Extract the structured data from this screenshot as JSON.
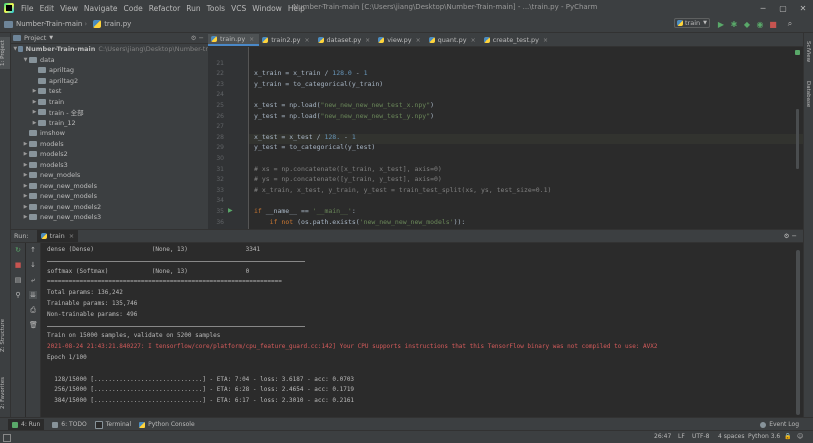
{
  "menu": [
    "File",
    "Edit",
    "View",
    "Navigate",
    "Code",
    "Refactor",
    "Run",
    "Tools",
    "VCS",
    "Window",
    "Help"
  ],
  "window_title": "Number-Train-main [C:\\Users\\jiang\\Desktop\\Number-Train-main] - ...\\train.py - PyCharm",
  "breadcrumb": {
    "project": "Number-Train-main",
    "file": "train.py"
  },
  "run_config": "train",
  "project": {
    "header": "Project",
    "root": "Number-Train-main",
    "root_path": "C:\\Users\\jiang\\Desktop\\Number-tr",
    "items": [
      {
        "label": "data",
        "indent": 1,
        "arrow": "▼"
      },
      {
        "label": "apriltag",
        "indent": 2,
        "arrow": ""
      },
      {
        "label": "apriltag2",
        "indent": 2,
        "arrow": ""
      },
      {
        "label": "test",
        "indent": 2,
        "arrow": "▶"
      },
      {
        "label": "train",
        "indent": 2,
        "arrow": "▶"
      },
      {
        "label": "train - 全部",
        "indent": 2,
        "arrow": "▶"
      },
      {
        "label": "train_12",
        "indent": 2,
        "arrow": "▶"
      },
      {
        "label": "imshow",
        "indent": 1,
        "arrow": ""
      },
      {
        "label": "models",
        "indent": 1,
        "arrow": "▶"
      },
      {
        "label": "models2",
        "indent": 1,
        "arrow": "▶"
      },
      {
        "label": "models3",
        "indent": 1,
        "arrow": "▶"
      },
      {
        "label": "new_models",
        "indent": 1,
        "arrow": "▶"
      },
      {
        "label": "new_new_models",
        "indent": 1,
        "arrow": "▶"
      },
      {
        "label": "new_new_models",
        "indent": 1,
        "arrow": "▶"
      },
      {
        "label": "new_new_models2",
        "indent": 1,
        "arrow": "▶"
      },
      {
        "label": "new_new_models3",
        "indent": 1,
        "arrow": "▶"
      }
    ]
  },
  "tabs": [
    {
      "label": "train.py",
      "active": true
    },
    {
      "label": "train2.py",
      "active": false
    },
    {
      "label": "dataset.py",
      "active": false
    },
    {
      "label": "view.py",
      "active": false
    },
    {
      "label": "quant.py",
      "active": false
    },
    {
      "label": "create_test.py",
      "active": false
    }
  ],
  "code_lines": [
    {
      "n": "",
      "text": ""
    },
    {
      "n": "21",
      "text": ""
    },
    {
      "n": "22",
      "text": "x_train = x_train / 128.0 - 1"
    },
    {
      "n": "23",
      "text": "y_train = to_categorical(y_train)"
    },
    {
      "n": "24",
      "text": ""
    },
    {
      "n": "25",
      "text": "x_test = np.load(\"new_new_new_new_test_x.npy\")"
    },
    {
      "n": "26",
      "text": "y_test = np.load(\"new_new_new_new_test_y.npy\")"
    },
    {
      "n": "27",
      "text": ""
    },
    {
      "n": "28",
      "text": "x_test = x_test / 128. - 1"
    },
    {
      "n": "29",
      "text": "y_test = to_categorical(y_test)"
    },
    {
      "n": "30",
      "text": ""
    },
    {
      "n": "31",
      "text": "# xs = np.concatenate([x_train, x_test], axis=0)"
    },
    {
      "n": "32",
      "text": "# ys = np.concatenate([y_train, y_test], axis=0)"
    },
    {
      "n": "33",
      "text": "# x_train, x_test, y_train, y_test = train_test_split(xs, ys, test_size=0.1)"
    },
    {
      "n": "34",
      "text": ""
    },
    {
      "n": "35",
      "text": "if __name__ == '__main__':"
    },
    {
      "n": "36",
      "text": "    if not (os.path.exists('new_new_new_new_models')):"
    }
  ],
  "run_panel": {
    "label": "Run:",
    "tab": "train"
  },
  "console": [
    {
      "text": "dense (Dense)                (None, 13)                3341",
      "kind": "normal"
    },
    {
      "text": "",
      "kind": "sep"
    },
    {
      "text": "softmax (Softmax)            (None, 13)                0",
      "kind": "normal"
    },
    {
      "text": "=================================================================",
      "kind": "normal"
    },
    {
      "text": "Total params: 136,242",
      "kind": "normal"
    },
    {
      "text": "Trainable params: 135,746",
      "kind": "normal"
    },
    {
      "text": "Non-trainable params: 496",
      "kind": "normal"
    },
    {
      "text": "",
      "kind": "sep"
    },
    {
      "text": "Train on 15000 samples, validate on 5200 samples",
      "kind": "normal"
    },
    {
      "text": "2021-08-24 21:43:21.840227: I tensorflow/core/platform/cpu_feature_guard.cc:142] Your CPU supports instructions that this TensorFlow binary was not compiled to use: AVX2",
      "kind": "err"
    },
    {
      "text": "Epoch 1/100",
      "kind": "normal"
    },
    {
      "text": "",
      "kind": "blank"
    },
    {
      "text": "  128/15000 [..............................] - ETA: 7:04 - loss: 3.6187 - acc: 0.0703",
      "kind": "normal"
    },
    {
      "text": "  256/15000 [..............................] - ETA: 6:28 - loss: 2.4654 - acc: 0.1719",
      "kind": "normal"
    },
    {
      "text": "  384/15000 [..............................] - ETA: 6:17 - loss: 2.3010 - acc: 0.2161",
      "kind": "normal"
    }
  ],
  "bottom_tools": [
    "4: Run",
    "6: TODO",
    "Terminal",
    "Python Console"
  ],
  "status": {
    "position": "26:47",
    "line_sep": "LF",
    "encoding": "UTF-8",
    "indent": "4 spaces",
    "interpreter": "Python 3.6",
    "event_log": "Event Log"
  },
  "side_tabs": {
    "left": [
      "1: Project",
      "Z: Structure",
      "2: Favorites"
    ],
    "right": [
      "SciView",
      "Database"
    ]
  }
}
